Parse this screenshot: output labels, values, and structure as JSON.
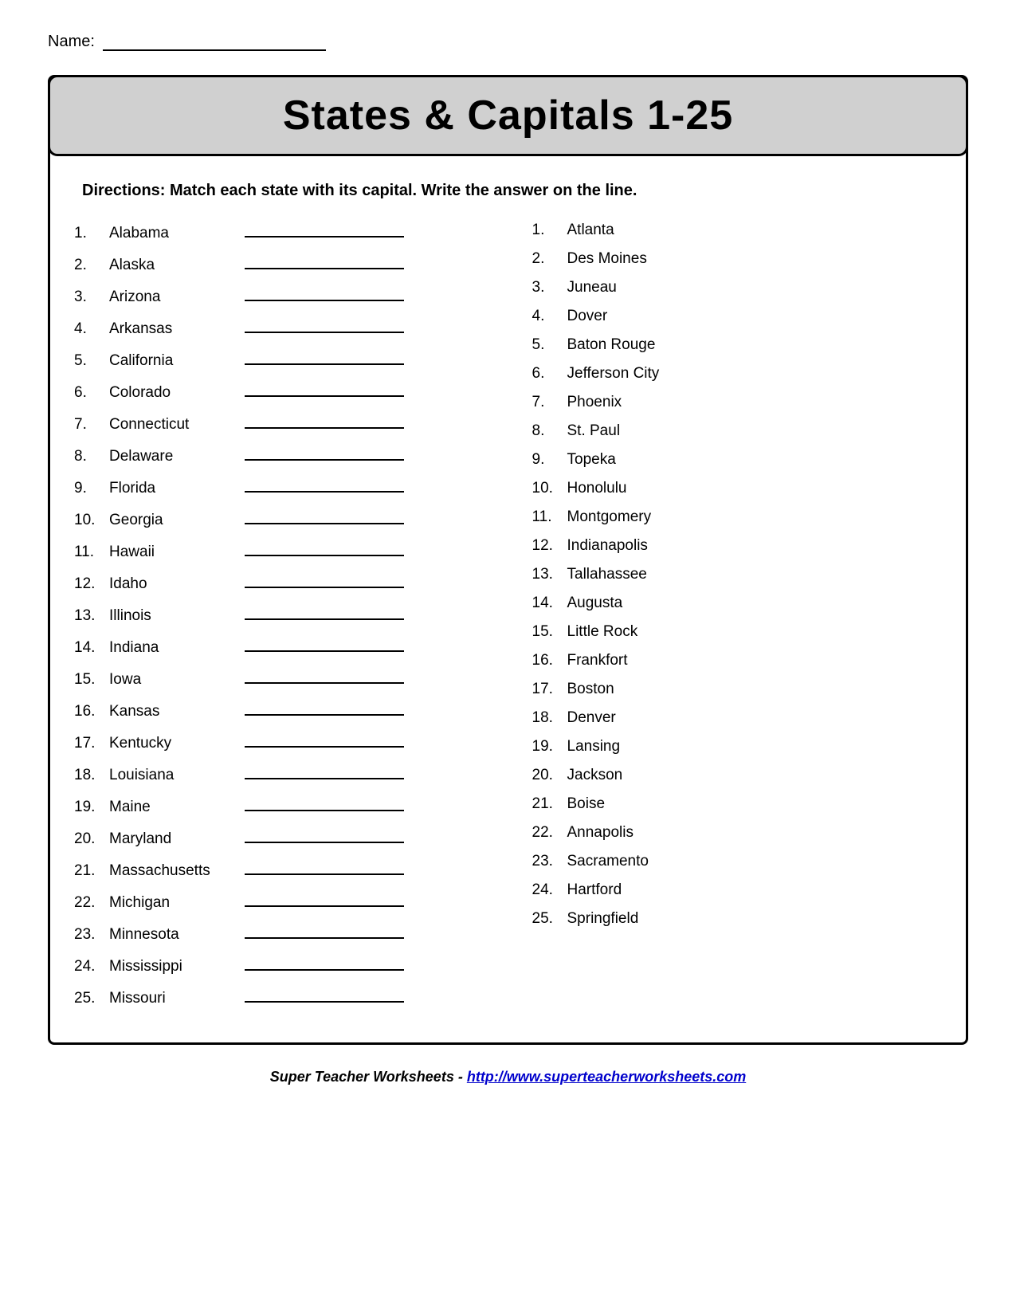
{
  "name_label": "Name:",
  "title": "States & Capitals  1-25",
  "directions": "Directions:  Match each state with its capital.  Write the answer on the line.",
  "states": [
    {
      "num": "1.",
      "name": "Alabama"
    },
    {
      "num": "2.",
      "name": "Alaska"
    },
    {
      "num": "3.",
      "name": "Arizona"
    },
    {
      "num": "4.",
      "name": "Arkansas"
    },
    {
      "num": "5.",
      "name": "California"
    },
    {
      "num": "6.",
      "name": "Colorado"
    },
    {
      "num": "7.",
      "name": "Connecticut"
    },
    {
      "num": "8.",
      "name": "Delaware"
    },
    {
      "num": "9.",
      "name": "Florida"
    },
    {
      "num": "10.",
      "name": "Georgia"
    },
    {
      "num": "11.",
      "name": "Hawaii"
    },
    {
      "num": "12.",
      "name": "Idaho"
    },
    {
      "num": "13.",
      "name": "Illinois"
    },
    {
      "num": "14.",
      "name": "Indiana"
    },
    {
      "num": "15.",
      "name": "Iowa"
    },
    {
      "num": "16.",
      "name": "Kansas"
    },
    {
      "num": "17.",
      "name": "Kentucky"
    },
    {
      "num": "18.",
      "name": "Louisiana"
    },
    {
      "num": "19.",
      "name": "Maine"
    },
    {
      "num": "20.",
      "name": "Maryland"
    },
    {
      "num": "21.",
      "name": "Massachusetts"
    },
    {
      "num": "22.",
      "name": "Michigan"
    },
    {
      "num": "23.",
      "name": "Minnesota"
    },
    {
      "num": "24.",
      "name": "Mississippi"
    },
    {
      "num": "25.",
      "name": "Missouri"
    }
  ],
  "capitals": [
    {
      "num": "1.",
      "name": "Atlanta"
    },
    {
      "num": "2.",
      "name": "Des Moines"
    },
    {
      "num": "3.",
      "name": "Juneau"
    },
    {
      "num": "4.",
      "name": "Dover"
    },
    {
      "num": "5.",
      "name": "Baton Rouge"
    },
    {
      "num": "6.",
      "name": "Jefferson City"
    },
    {
      "num": "7.",
      "name": "Phoenix"
    },
    {
      "num": "8.",
      "name": "St. Paul"
    },
    {
      "num": "9.",
      "name": "Topeka"
    },
    {
      "num": "10.",
      "name": "Honolulu"
    },
    {
      "num": "11.",
      "name": "Montgomery"
    },
    {
      "num": "12.",
      "name": "Indianapolis"
    },
    {
      "num": "13.",
      "name": "Tallahassee"
    },
    {
      "num": "14.",
      "name": "Augusta"
    },
    {
      "num": "15.",
      "name": "Little Rock"
    },
    {
      "num": "16.",
      "name": "Frankfort"
    },
    {
      "num": "17.",
      "name": "Boston"
    },
    {
      "num": "18.",
      "name": "Denver"
    },
    {
      "num": "19.",
      "name": "Lansing"
    },
    {
      "num": "20.",
      "name": "Jackson"
    },
    {
      "num": "21.",
      "name": "Boise"
    },
    {
      "num": "22.",
      "name": "Annapolis"
    },
    {
      "num": "23.",
      "name": "Sacramento"
    },
    {
      "num": "24.",
      "name": "Hartford"
    },
    {
      "num": "25.",
      "name": "Springfield"
    }
  ],
  "footer_text": "Super Teacher Worksheets  -  ",
  "footer_link": "http://www.superteacherworksheets.com"
}
